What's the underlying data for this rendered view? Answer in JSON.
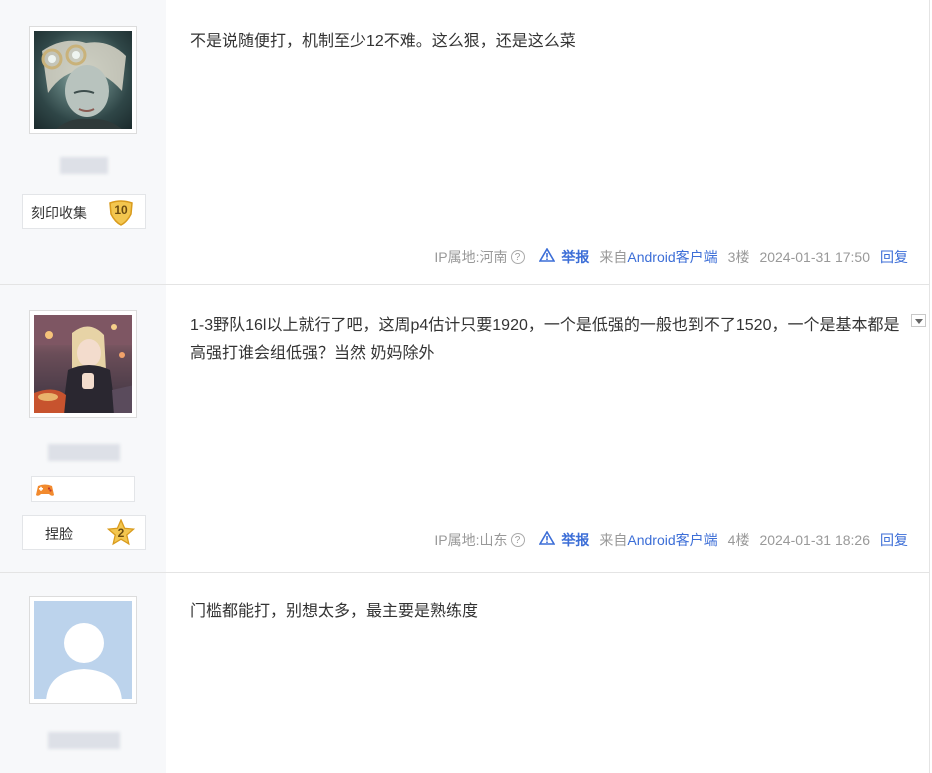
{
  "posts": [
    {
      "content": "不是说随便打，机制至少12不难。这么狠，还是这么菜",
      "badge": {
        "label": "刻印收集",
        "level": "10"
      },
      "meta": {
        "ip": "IP属地:河南",
        "report": "举报",
        "source_prefix": "来自",
        "source_link": "Android客户端",
        "floor": "3楼",
        "time": "2024-01-31 17:50",
        "reply": "回复"
      }
    },
    {
      "content": "1-3野队16l以上就行了吧，这周p4估计只要1920，一个是低强的一般也到不了1520，一个是基本都是高强打谁会组低强？当然 奶妈除外",
      "badge": {
        "label": "捏脸",
        "level": "2"
      },
      "meta": {
        "ip": "IP属地:山东",
        "report": "举报",
        "source_prefix": "来自",
        "source_link": "Android客户端",
        "floor": "4楼",
        "time": "2024-01-31 18:26",
        "reply": "回复"
      }
    },
    {
      "content": "门槛都能打，别想太多，最主要是熟练度"
    }
  ],
  "icons": {
    "help": "question-circle-icon",
    "report": "warning-triangle-icon",
    "dropdown": "chevron-down-icon",
    "medal": "shield-medal-icon",
    "star": "star-medal-icon",
    "gamepad": "gamepad-icon"
  },
  "colors": {
    "link": "#3c6ed7",
    "meta": "#999999",
    "sidebar": "#f7f8fa"
  }
}
